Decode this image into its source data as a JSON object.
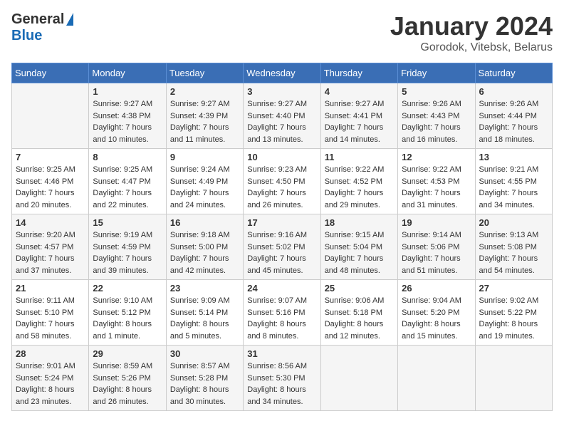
{
  "logo": {
    "general": "General",
    "blue": "Blue"
  },
  "title": {
    "month": "January 2024",
    "location": "Gorodok, Vitebsk, Belarus"
  },
  "weekdays": [
    "Sunday",
    "Monday",
    "Tuesday",
    "Wednesday",
    "Thursday",
    "Friday",
    "Saturday"
  ],
  "weeks": [
    [
      {
        "day": "",
        "sunrise": "",
        "sunset": "",
        "daylight": ""
      },
      {
        "day": "1",
        "sunrise": "Sunrise: 9:27 AM",
        "sunset": "Sunset: 4:38 PM",
        "daylight": "Daylight: 7 hours and 10 minutes."
      },
      {
        "day": "2",
        "sunrise": "Sunrise: 9:27 AM",
        "sunset": "Sunset: 4:39 PM",
        "daylight": "Daylight: 7 hours and 11 minutes."
      },
      {
        "day": "3",
        "sunrise": "Sunrise: 9:27 AM",
        "sunset": "Sunset: 4:40 PM",
        "daylight": "Daylight: 7 hours and 13 minutes."
      },
      {
        "day": "4",
        "sunrise": "Sunrise: 9:27 AM",
        "sunset": "Sunset: 4:41 PM",
        "daylight": "Daylight: 7 hours and 14 minutes."
      },
      {
        "day": "5",
        "sunrise": "Sunrise: 9:26 AM",
        "sunset": "Sunset: 4:43 PM",
        "daylight": "Daylight: 7 hours and 16 minutes."
      },
      {
        "day": "6",
        "sunrise": "Sunrise: 9:26 AM",
        "sunset": "Sunset: 4:44 PM",
        "daylight": "Daylight: 7 hours and 18 minutes."
      }
    ],
    [
      {
        "day": "7",
        "sunrise": "Sunrise: 9:25 AM",
        "sunset": "Sunset: 4:46 PM",
        "daylight": "Daylight: 7 hours and 20 minutes."
      },
      {
        "day": "8",
        "sunrise": "Sunrise: 9:25 AM",
        "sunset": "Sunset: 4:47 PM",
        "daylight": "Daylight: 7 hours and 22 minutes."
      },
      {
        "day": "9",
        "sunrise": "Sunrise: 9:24 AM",
        "sunset": "Sunset: 4:49 PM",
        "daylight": "Daylight: 7 hours and 24 minutes."
      },
      {
        "day": "10",
        "sunrise": "Sunrise: 9:23 AM",
        "sunset": "Sunset: 4:50 PM",
        "daylight": "Daylight: 7 hours and 26 minutes."
      },
      {
        "day": "11",
        "sunrise": "Sunrise: 9:22 AM",
        "sunset": "Sunset: 4:52 PM",
        "daylight": "Daylight: 7 hours and 29 minutes."
      },
      {
        "day": "12",
        "sunrise": "Sunrise: 9:22 AM",
        "sunset": "Sunset: 4:53 PM",
        "daylight": "Daylight: 7 hours and 31 minutes."
      },
      {
        "day": "13",
        "sunrise": "Sunrise: 9:21 AM",
        "sunset": "Sunset: 4:55 PM",
        "daylight": "Daylight: 7 hours and 34 minutes."
      }
    ],
    [
      {
        "day": "14",
        "sunrise": "Sunrise: 9:20 AM",
        "sunset": "Sunset: 4:57 PM",
        "daylight": "Daylight: 7 hours and 37 minutes."
      },
      {
        "day": "15",
        "sunrise": "Sunrise: 9:19 AM",
        "sunset": "Sunset: 4:59 PM",
        "daylight": "Daylight: 7 hours and 39 minutes."
      },
      {
        "day": "16",
        "sunrise": "Sunrise: 9:18 AM",
        "sunset": "Sunset: 5:00 PM",
        "daylight": "Daylight: 7 hours and 42 minutes."
      },
      {
        "day": "17",
        "sunrise": "Sunrise: 9:16 AM",
        "sunset": "Sunset: 5:02 PM",
        "daylight": "Daylight: 7 hours and 45 minutes."
      },
      {
        "day": "18",
        "sunrise": "Sunrise: 9:15 AM",
        "sunset": "Sunset: 5:04 PM",
        "daylight": "Daylight: 7 hours and 48 minutes."
      },
      {
        "day": "19",
        "sunrise": "Sunrise: 9:14 AM",
        "sunset": "Sunset: 5:06 PM",
        "daylight": "Daylight: 7 hours and 51 minutes."
      },
      {
        "day": "20",
        "sunrise": "Sunrise: 9:13 AM",
        "sunset": "Sunset: 5:08 PM",
        "daylight": "Daylight: 7 hours and 54 minutes."
      }
    ],
    [
      {
        "day": "21",
        "sunrise": "Sunrise: 9:11 AM",
        "sunset": "Sunset: 5:10 PM",
        "daylight": "Daylight: 7 hours and 58 minutes."
      },
      {
        "day": "22",
        "sunrise": "Sunrise: 9:10 AM",
        "sunset": "Sunset: 5:12 PM",
        "daylight": "Daylight: 8 hours and 1 minute."
      },
      {
        "day": "23",
        "sunrise": "Sunrise: 9:09 AM",
        "sunset": "Sunset: 5:14 PM",
        "daylight": "Daylight: 8 hours and 5 minutes."
      },
      {
        "day": "24",
        "sunrise": "Sunrise: 9:07 AM",
        "sunset": "Sunset: 5:16 PM",
        "daylight": "Daylight: 8 hours and 8 minutes."
      },
      {
        "day": "25",
        "sunrise": "Sunrise: 9:06 AM",
        "sunset": "Sunset: 5:18 PM",
        "daylight": "Daylight: 8 hours and 12 minutes."
      },
      {
        "day": "26",
        "sunrise": "Sunrise: 9:04 AM",
        "sunset": "Sunset: 5:20 PM",
        "daylight": "Daylight: 8 hours and 15 minutes."
      },
      {
        "day": "27",
        "sunrise": "Sunrise: 9:02 AM",
        "sunset": "Sunset: 5:22 PM",
        "daylight": "Daylight: 8 hours and 19 minutes."
      }
    ],
    [
      {
        "day": "28",
        "sunrise": "Sunrise: 9:01 AM",
        "sunset": "Sunset: 5:24 PM",
        "daylight": "Daylight: 8 hours and 23 minutes."
      },
      {
        "day": "29",
        "sunrise": "Sunrise: 8:59 AM",
        "sunset": "Sunset: 5:26 PM",
        "daylight": "Daylight: 8 hours and 26 minutes."
      },
      {
        "day": "30",
        "sunrise": "Sunrise: 8:57 AM",
        "sunset": "Sunset: 5:28 PM",
        "daylight": "Daylight: 8 hours and 30 minutes."
      },
      {
        "day": "31",
        "sunrise": "Sunrise: 8:56 AM",
        "sunset": "Sunset: 5:30 PM",
        "daylight": "Daylight: 8 hours and 34 minutes."
      },
      {
        "day": "",
        "sunrise": "",
        "sunset": "",
        "daylight": ""
      },
      {
        "day": "",
        "sunrise": "",
        "sunset": "",
        "daylight": ""
      },
      {
        "day": "",
        "sunrise": "",
        "sunset": "",
        "daylight": ""
      }
    ]
  ]
}
